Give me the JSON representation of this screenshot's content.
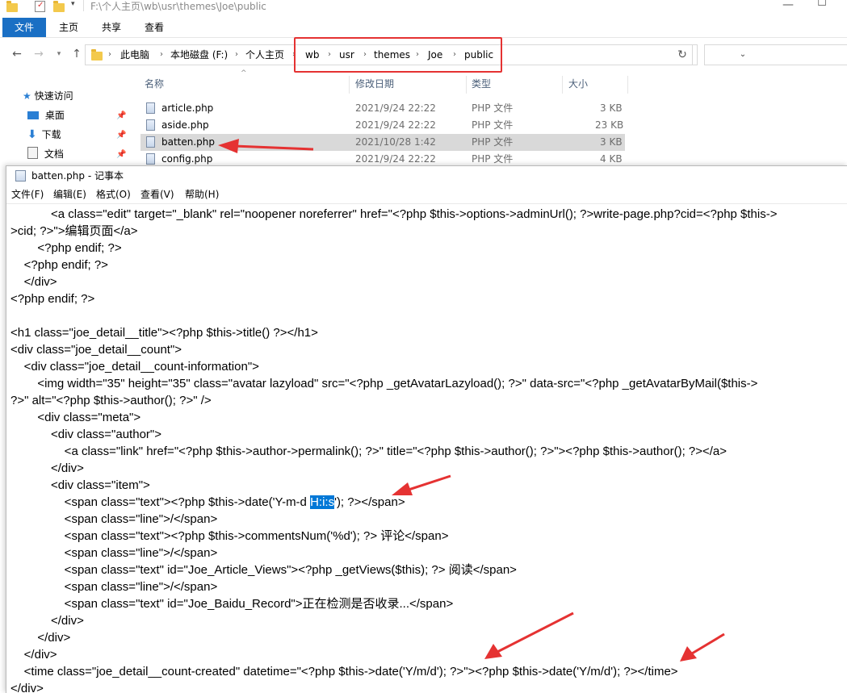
{
  "explorer": {
    "title_path": "F:\\个人主页\\wb\\usr\\themes\\Joe\\public",
    "ribbon_tabs": [
      "文件",
      "主页",
      "共享",
      "查看"
    ],
    "breadcrumb": [
      "此电脑",
      "本地磁盘 (F:)",
      "个人主页",
      "wb",
      "usr",
      "themes",
      "Joe",
      "public"
    ],
    "nav_items": [
      {
        "label": "快速访问",
        "icon": "star-icon"
      },
      {
        "label": "桌面",
        "icon": "desktop-icon"
      },
      {
        "label": "下载",
        "icon": "download-icon"
      },
      {
        "label": "文档",
        "icon": "document-icon"
      }
    ],
    "columns": [
      "名称",
      "修改日期",
      "类型",
      "大小"
    ],
    "files": [
      {
        "name": "article.php",
        "date": "2021/9/24 22:22",
        "type": "PHP 文件",
        "size": "3 KB"
      },
      {
        "name": "aside.php",
        "date": "2021/9/24 22:22",
        "type": "PHP 文件",
        "size": "23 KB"
      },
      {
        "name": "batten.php",
        "date": "2021/10/28 1:42",
        "type": "PHP 文件",
        "size": "3 KB",
        "selected": true
      },
      {
        "name": "config.php",
        "date": "2021/9/24 22:22",
        "type": "PHP 文件",
        "size": "4 KB"
      }
    ]
  },
  "notepad": {
    "title": "batten.php - 记事本",
    "menu": [
      "文件(F)",
      "编辑(E)",
      "格式(O)",
      "查看(V)",
      "帮助(H)"
    ],
    "code_lines": [
      "            <a class=\"edit\" target=\"_blank\" rel=\"noopener noreferrer\" href=\"<?php $this->options->adminUrl(); ?>write-page.php?cid=<?php $this->",
      ">cid; ?>\">编辑页面</a>",
      "        <?php endif; ?>",
      "    <?php endif; ?>",
      "    </div>",
      "<?php endif; ?>",
      "",
      "<h1 class=\"joe_detail__title\"><?php $this->title() ?></h1>",
      "<div class=\"joe_detail__count\">",
      "    <div class=\"joe_detail__count-information\">",
      "        <img width=\"35\" height=\"35\" class=\"avatar lazyload\" src=\"<?php _getAvatarLazyload(); ?>\" data-src=\"<?php _getAvatarByMail($this->",
      "?>\" alt=\"<?php $this->author(); ?>\" />",
      "        <div class=\"meta\">",
      "            <div class=\"author\">",
      "                <a class=\"link\" href=\"<?php $this->author->permalink(); ?>\" title=\"<?php $this->author(); ?>\"><?php $this->author(); ?></a>",
      "            </div>",
      "            <div class=\"item\">",
      "",
      "                <span class=\"line\">/</span>",
      "                <span class=\"text\"><?php $this->commentsNum('%d'); ?> 评论</span>",
      "                <span class=\"line\">/</span>",
      "                <span class=\"text\" id=\"Joe_Article_Views\"><?php _getViews($this); ?> 阅读</span>",
      "                <span class=\"line\">/</span>",
      "                <span class=\"text\" id=\"Joe_Baidu_Record\">正在检测是否收录...</span>",
      "            </div>",
      "        </div>",
      "    </div>",
      "    <time class=\"joe_detail__count-created\" datetime=\"<?php $this->date('Y/m/d'); ?>\"><?php $this->date('Y/m/d'); ?></time>",
      "</div>"
    ],
    "date_line": {
      "before": "                <span class=\"text\"><?php $this->date('Y-m-d ",
      "selected": "H:i:s",
      "after": "'); ?></span>"
    }
  },
  "annotation_color": "#e53232"
}
